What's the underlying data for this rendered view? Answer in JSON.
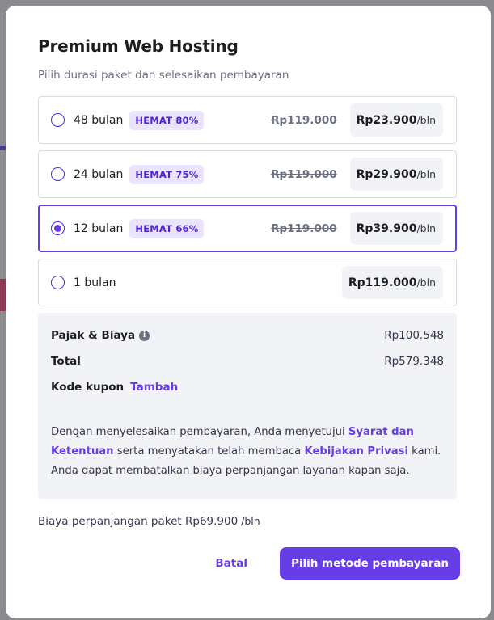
{
  "modal": {
    "title": "Premium Web Hosting",
    "subtitle": "Pilih durasi paket dan selesaikan pembayaran"
  },
  "plans": [
    {
      "label": "48 bulan",
      "badge": "HEMAT 80%",
      "old_price": "Rp119.000",
      "price": "Rp23.900",
      "per": "/bln",
      "selected": false
    },
    {
      "label": "24 bulan",
      "badge": "HEMAT 75%",
      "old_price": "Rp119.000",
      "price": "Rp29.900",
      "per": "/bln",
      "selected": false
    },
    {
      "label": "12 bulan",
      "badge": "HEMAT 66%",
      "old_price": "Rp119.000",
      "price": "Rp39.900",
      "per": "/bln",
      "selected": true
    },
    {
      "label": "1 bulan",
      "badge": "",
      "old_price": "",
      "price": "Rp119.000",
      "per": "/bln",
      "selected": false
    }
  ],
  "summary": {
    "tax_label": "Pajak & Biaya",
    "tax_value": "Rp100.548",
    "total_label": "Total",
    "total_value": "Rp579.348",
    "coupon_label": "Kode kupon",
    "coupon_link": "Tambah",
    "terms_1": "Dengan menyelesaikan pembayaran, Anda menyetujui ",
    "terms_link_1": "Syarat dan Ketentuan",
    "terms_2": " serta menyatakan telah membaca ",
    "terms_link_2": "Kebijakan Privasi",
    "terms_3": " kami. Anda dapat membatalkan biaya perpanjangan layanan kapan saja."
  },
  "renewal": {
    "text": "Biaya perpanjangan paket Rp69.900",
    "per": " /bln"
  },
  "actions": {
    "cancel_label": "Batal",
    "pay_label": "Pilih metode pembayaran"
  },
  "colors": {
    "accent": "#673de6",
    "badge_bg": "#ebe4ff",
    "summary_bg": "#f2f3f6"
  }
}
